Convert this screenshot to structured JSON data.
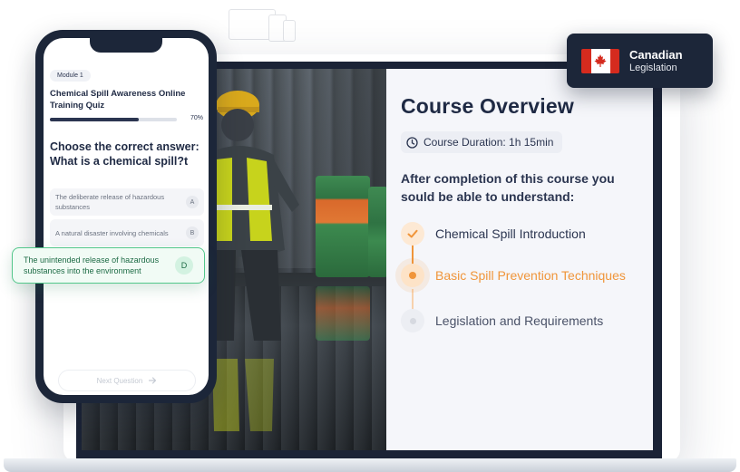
{
  "background_header": {
    "line1": "",
    "line2": ""
  },
  "course": {
    "title": "Course Overview",
    "duration": "Course Duration: 1h 15min",
    "intro": "After completion of this course you sould be able to understand:",
    "steps": [
      {
        "label": "Chemical Spill Introduction",
        "state": "completed"
      },
      {
        "label": "Basic Spill Prevention Techniques",
        "state": "active"
      },
      {
        "label": "Legislation and Requirements",
        "state": "upcoming"
      }
    ],
    "colors": {
      "accent": "#f0953a",
      "completed_text": "#2b3550",
      "upcoming_text": "#4a5268"
    }
  },
  "legislation_badge": {
    "title": "Canadian",
    "subtitle": "Legislation",
    "flag_icon": "canada-flag-icon"
  },
  "phone": {
    "module": "Module 1",
    "quiz_title": "Chemical Spill Awareness Online Training Quiz",
    "progress_percent": 70,
    "progress_label": "70%",
    "question": "Choose the correct answer: What is a chemical spill?t",
    "answers": [
      {
        "text": "The deliberate release of hazardous substances",
        "letter": "A"
      },
      {
        "text": "A natural disaster involving chemicals",
        "letter": "B"
      }
    ],
    "selected_answer": {
      "text": "The unintended release of hazardous substances into the environment",
      "letter": "D"
    },
    "next_button": "Next Question"
  }
}
